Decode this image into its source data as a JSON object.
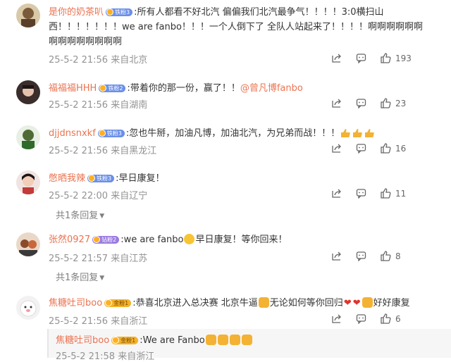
{
  "comments": [
    {
      "username": "是你的奶茶叭",
      "badge": "铁粉3",
      "prefix": ":",
      "text_1": "所有人都看不好北汽 偏偏我们北汽最争气！！！！3:0横扫山",
      "text_2": "西！！！！！！！we are fanbo！！！一个人倒下了 全队人站起来了！！！！啊啊啊啊啊啊",
      "text_3": "啊啊啊啊啊啊啊啊",
      "time": "25-5-2 21:56",
      "location": "来自北京",
      "likes": "193"
    },
    {
      "username": "福福福HHH",
      "badge": "铁粉2",
      "prefix": ":",
      "text": "带着你的那一份，赢了！！",
      "mention": "@曾凡博fanbo",
      "time": "25-5-2 21:56",
      "location": "来自湖南",
      "likes": "23"
    },
    {
      "username": "djjdnsnxkf",
      "badge": "铁粉3",
      "prefix": ":",
      "text": "忽也牛掰，加油凡博，加油北汽，为兄弟而战！！！",
      "time": "25-5-2 21:56",
      "location": "来自黑龙江",
      "likes": "16"
    },
    {
      "username": "憋晒我辣",
      "badge": "铁粉3",
      "prefix": ":",
      "text": "早日康复！",
      "time": "25-5-2 22:00",
      "location": "来自辽宁",
      "likes": "11",
      "replies": "共1条回复"
    },
    {
      "username": "张然0927",
      "badge": "钻粉2",
      "prefix": ":",
      "text_a": "we are fanbo",
      "text_b": "早日康复！等你回来！",
      "time": "25-5-2 21:57",
      "location": "来自江苏",
      "likes": "8",
      "replies": "共1条回复"
    },
    {
      "username": "焦糖吐司boo",
      "badge": "金粉1",
      "prefix": ":",
      "text_a": "恭喜北京进入总决赛 北京牛逼",
      "text_b": "无论如何等你回归",
      "text_c": "好好康复",
      "time": "25-5-2 21:56",
      "location": "来自浙江",
      "likes": "6"
    }
  ],
  "nested_reply": {
    "username": "焦糖吐司boo",
    "badge": "金粉1",
    "text": ":We are Fanbo",
    "time": "25-5-2 21:58",
    "location": "来自浙江"
  },
  "icons": [
    "share-icon",
    "comment-icon",
    "like-icon",
    "emoji-icon",
    "thumbs-up-icon",
    "heart-icon",
    "muscle-icon"
  ],
  "colors": {
    "username": "#eb7350",
    "meta": "#939393",
    "text": "#333333"
  }
}
